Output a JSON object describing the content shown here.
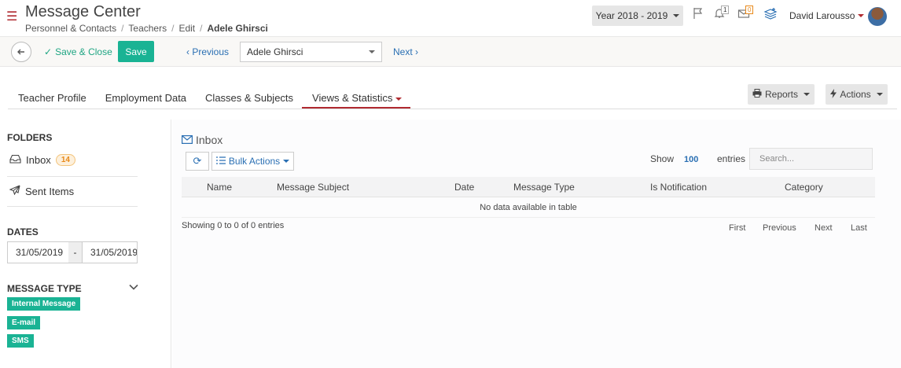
{
  "header": {
    "title": "Message Center",
    "breadcrumb": [
      "Personnel & Contacts",
      "Teachers",
      "Edit",
      "Adele Ghirsci"
    ],
    "year_select": "Year 2018 - 2019",
    "notif_count": "1",
    "mail_count": "0",
    "user_name": "David Larousso"
  },
  "toolbar": {
    "save_close": "Save & Close",
    "save": "Save",
    "previous": "Previous",
    "record": "Adele Ghirsci",
    "next": "Next"
  },
  "tabs": [
    {
      "label": "Teacher Profile"
    },
    {
      "label": "Employment Data"
    },
    {
      "label": "Classes & Subjects"
    },
    {
      "label": "Views & Statistics"
    }
  ],
  "actions": {
    "reports": "Reports",
    "actions": "Actions"
  },
  "sidebar": {
    "folders_heading": "FOLDERS",
    "folders": [
      {
        "label": "Inbox",
        "count": "14"
      },
      {
        "label": "Sent Items"
      }
    ],
    "dates_heading": "DATES",
    "date_from": "31/05/2019",
    "date_sep": "-",
    "date_to": "31/05/2019",
    "message_type_heading": "MESSAGE TYPE",
    "types": [
      "Internal Message",
      "E-mail",
      "SMS"
    ]
  },
  "main": {
    "title": "Inbox",
    "bulk_actions": "Bulk Actions",
    "show_label": "Show",
    "show_value": "100",
    "entries_label": "entries",
    "search_placeholder": "Search...",
    "columns": [
      "Name",
      "Message Subject",
      "Date",
      "Message Type",
      "Is Notification",
      "Category"
    ],
    "empty_text": "No data available in table",
    "info": "Showing 0 to 0 of 0 entries",
    "pager": [
      "First",
      "Previous",
      "Next",
      "Last"
    ]
  }
}
